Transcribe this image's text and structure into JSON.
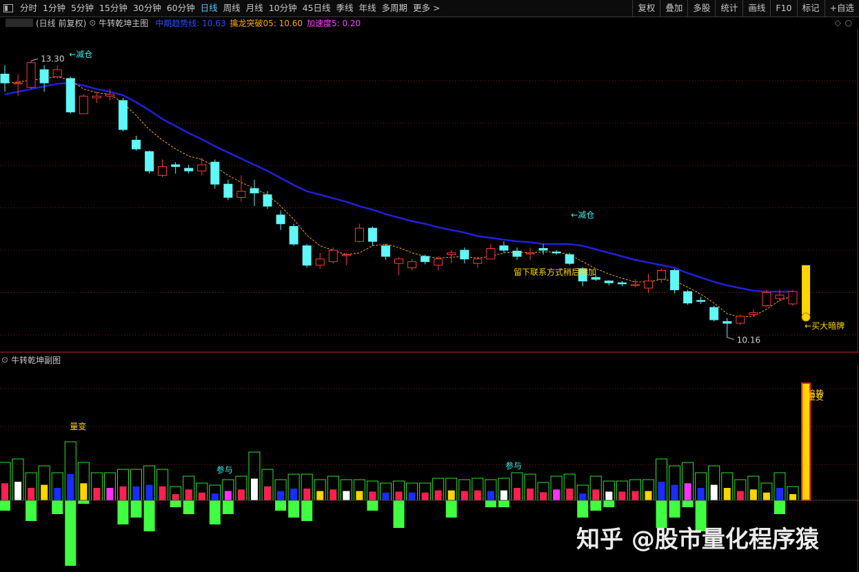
{
  "toolbar": {
    "periods": [
      "分时",
      "1分钟",
      "5分钟",
      "15分钟",
      "30分钟",
      "60分钟",
      "日线",
      "周线",
      "月线",
      "10分钟",
      "45日线",
      "季线",
      "年线",
      "多周期",
      "更多 >"
    ],
    "active_period": "日线",
    "right_buttons": [
      "复权",
      "叠加",
      "多股",
      "统计",
      "画线",
      "F10",
      "标记",
      "+自选"
    ]
  },
  "main_panel": {
    "header_prefix": "(日线 前复权)",
    "indicator_name": "牛转乾坤主图",
    "mid_line_label": "中期趋势线: 10.63",
    "breakout_label": "擒龙突破05: 10.60",
    "accel_label": "加速度5: 0.20",
    "high_label": "13.30",
    "low_label": "10.16",
    "annotations": [
      "←减仓",
      "←减仓",
      "←买大暗牌"
    ],
    "notice_text": "留下联系方式稍后添加",
    "colors": {
      "up": "#ff3a3a",
      "down": "#5ff7f7",
      "trend_line": "#2020e0",
      "fast_line": "#ffaa00",
      "grid": "#8b1a1a",
      "signal": "#ffd400"
    }
  },
  "sub_panel": {
    "title": "牛转乾坤副图",
    "labels": [
      "量变",
      "参与",
      "参与",
      "追势",
      "量变"
    ]
  },
  "chart_data": {
    "type": "candlestick",
    "price_range": [
      10.0,
      13.6
    ],
    "candles": [
      [
        13.15,
        13.05,
        13.25,
        12.95
      ],
      [
        13.05,
        13.05,
        13.15,
        12.9
      ],
      [
        13.0,
        13.28,
        13.3,
        12.98
      ],
      [
        13.2,
        13.05,
        13.25,
        12.95
      ],
      [
        13.12,
        13.2,
        13.25,
        13.1
      ],
      [
        13.1,
        12.72,
        13.12,
        12.7
      ],
      [
        12.7,
        12.9,
        12.92,
        12.7
      ],
      [
        12.88,
        12.9,
        12.95,
        12.82
      ],
      [
        12.9,
        12.92,
        12.98,
        12.85
      ],
      [
        12.85,
        12.52,
        12.88,
        12.5
      ],
      [
        12.4,
        12.3,
        12.45,
        12.28
      ],
      [
        12.27,
        12.05,
        12.28,
        12.02
      ],
      [
        12.0,
        12.1,
        12.18,
        11.98
      ],
      [
        12.12,
        12.1,
        12.15,
        12.02
      ],
      [
        12.08,
        12.05,
        12.12,
        12.02
      ],
      [
        12.05,
        12.12,
        12.2,
        12.0
      ],
      [
        12.15,
        11.9,
        12.18,
        11.85
      ],
      [
        11.9,
        11.75,
        11.95,
        11.72
      ],
      [
        11.75,
        11.82,
        12.0,
        11.7
      ],
      [
        11.85,
        11.8,
        11.95,
        11.65
      ],
      [
        11.78,
        11.65,
        11.82,
        11.62
      ],
      [
        11.55,
        11.45,
        11.6,
        11.38
      ],
      [
        11.42,
        11.22,
        11.45,
        11.2
      ],
      [
        11.2,
        10.98,
        11.22,
        10.95
      ],
      [
        10.98,
        11.05,
        11.12,
        10.94
      ],
      [
        11.02,
        11.15,
        11.18,
        11.0
      ],
      [
        11.1,
        11.1,
        11.12,
        10.98
      ],
      [
        11.25,
        11.4,
        11.45,
        11.24
      ],
      [
        11.4,
        11.25,
        11.42,
        11.2
      ],
      [
        11.2,
        11.08,
        11.22,
        11.04
      ],
      [
        11.0,
        11.05,
        11.07,
        10.87
      ],
      [
        10.95,
        11.02,
        11.05,
        10.92
      ],
      [
        11.08,
        11.02,
        11.1,
        10.99
      ],
      [
        10.98,
        11.05,
        11.08,
        10.92
      ],
      [
        11.1,
        11.12,
        11.15,
        11.0
      ],
      [
        11.15,
        11.05,
        11.18,
        11.0
      ],
      [
        11.0,
        11.05,
        11.07,
        10.95
      ],
      [
        11.05,
        11.17,
        11.22,
        11.05
      ],
      [
        11.2,
        11.15,
        11.25,
        11.12
      ],
      [
        11.14,
        11.08,
        11.18,
        11.04
      ],
      [
        11.12,
        11.12,
        11.18,
        11.04
      ],
      [
        11.17,
        11.15,
        11.22,
        11.1
      ],
      [
        11.13,
        11.12,
        11.15,
        11.1
      ],
      [
        11.1,
        11.0,
        11.12,
        10.98
      ],
      [
        10.94,
        10.8,
        10.96,
        10.74
      ],
      [
        10.84,
        10.82,
        10.86,
        10.8
      ],
      [
        10.8,
        10.78,
        10.81,
        10.75
      ],
      [
        10.78,
        10.77,
        10.8,
        10.74
      ],
      [
        10.75,
        10.76,
        10.82,
        10.73
      ],
      [
        10.72,
        10.8,
        10.88,
        10.66
      ],
      [
        10.82,
        10.92,
        10.94,
        10.78
      ],
      [
        10.92,
        10.7,
        10.94,
        10.66
      ],
      [
        10.68,
        10.55,
        10.7,
        10.53
      ],
      [
        10.58,
        10.57,
        10.62,
        10.54
      ],
      [
        10.5,
        10.36,
        10.52,
        10.34
      ],
      [
        10.34,
        10.32,
        10.38,
        10.16
      ],
      [
        10.32,
        10.4,
        10.42,
        10.3
      ],
      [
        10.42,
        10.44,
        10.48,
        10.4
      ],
      [
        10.52,
        10.67,
        10.7,
        10.5
      ],
      [
        10.6,
        10.64,
        10.7,
        10.57
      ],
      [
        10.54,
        10.68,
        10.7,
        10.52
      ]
    ],
    "trend_line": [
      12.92,
      12.95,
      12.98,
      13.01,
      13.04,
      13.05,
      13.02,
      12.98,
      12.95,
      12.91,
      12.83,
      12.74,
      12.64,
      12.56,
      12.48,
      12.41,
      12.33,
      12.26,
      12.19,
      12.12,
      12.05,
      11.97,
      11.89,
      11.82,
      11.78,
      11.74,
      11.7,
      11.65,
      11.61,
      11.56,
      11.52,
      11.48,
      11.45,
      11.41,
      11.38,
      11.35,
      11.31,
      11.29,
      11.27,
      11.25,
      11.24,
      11.22,
      11.22,
      11.22,
      11.2,
      11.16,
      11.12,
      11.08,
      11.04,
      11.01,
      10.98,
      10.95,
      10.89,
      10.84,
      10.79,
      10.75,
      10.72,
      10.69,
      10.68,
      10.68,
      10.68
    ],
    "fast_line": [
      13.05,
      13.06,
      13.08,
      13.1,
      13.12,
      13.08,
      12.98,
      12.94,
      12.92,
      12.82,
      12.68,
      12.52,
      12.4,
      12.3,
      12.22,
      12.18,
      12.1,
      12.0,
      11.92,
      11.85,
      11.78,
      11.65,
      11.5,
      11.32,
      11.2,
      11.15,
      11.1,
      11.12,
      11.2,
      11.22,
      11.18,
      11.12,
      11.08,
      11.06,
      11.07,
      11.08,
      11.06,
      11.08,
      11.12,
      11.13,
      11.12,
      11.13,
      11.13,
      11.1,
      11.02,
      10.94,
      10.88,
      10.83,
      10.79,
      10.79,
      10.82,
      10.8,
      10.73,
      10.65,
      10.55,
      10.43,
      10.39,
      10.4,
      10.48,
      10.58,
      10.63
    ],
    "sub_bars_top": [
      55,
      60,
      40,
      50,
      40,
      85,
      55,
      40,
      40,
      45,
      45,
      50,
      45,
      20,
      35,
      25,
      22,
      30,
      35,
      70,
      45,
      30,
      38,
      38,
      30,
      35,
      30,
      30,
      28,
      25,
      28,
      25,
      25,
      32,
      32,
      30,
      32,
      30,
      32,
      40,
      38,
      26,
      35,
      38,
      22,
      35,
      28,
      28,
      30,
      30,
      60,
      50,
      55,
      40,
      50,
      40,
      30,
      35,
      25,
      40,
      20,
      170
    ],
    "sub_bars_bot": [
      -15,
      0,
      -30,
      0,
      -20,
      -95,
      -5,
      0,
      0,
      -35,
      -25,
      -45,
      0,
      -10,
      -20,
      0,
      -35,
      -20,
      0,
      0,
      0,
      -15,
      -25,
      -30,
      0,
      0,
      0,
      0,
      -15,
      0,
      -40,
      0,
      0,
      0,
      -25,
      0,
      0,
      -10,
      -10,
      0,
      0,
      0,
      0,
      0,
      -25,
      -15,
      -10,
      0,
      0,
      0,
      -40,
      -25,
      -10,
      -45,
      0,
      0,
      0,
      0,
      0,
      -20,
      0
    ],
    "sub_bar_fill": [
      "r",
      "w",
      "r",
      "y",
      "b",
      "b",
      "y",
      "r",
      "m",
      "r",
      "b",
      "b",
      "r",
      "r",
      "r",
      "r",
      "b",
      "m",
      "r",
      "w",
      "r",
      "b",
      "b",
      "r",
      "y",
      "r",
      "w",
      "y",
      "r",
      "b",
      "r",
      "b",
      "r",
      "r",
      "y",
      "r",
      "r",
      "b",
      "w",
      "r",
      "r",
      "r",
      "m",
      "r",
      "b",
      "r",
      "w",
      "r",
      "r",
      "y",
      "b",
      "b",
      "m",
      "b",
      "w",
      "y",
      "r",
      "y",
      "y",
      "b",
      "y"
    ]
  },
  "watermark": "知乎 @股市量化程序猿"
}
